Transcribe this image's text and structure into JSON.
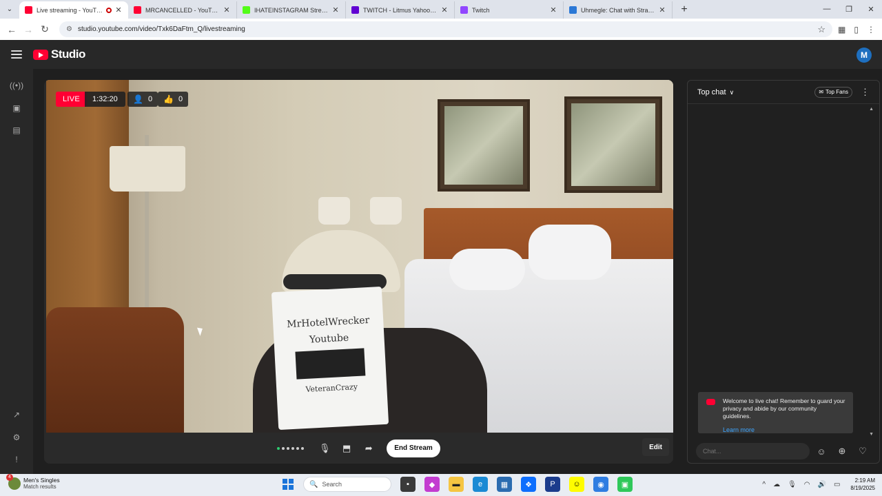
{
  "browser": {
    "tabs": [
      {
        "title": "Live streaming - YouTube Studio",
        "icon": "youtube-studio-icon",
        "color": "#ff0033",
        "active": true,
        "recording": true
      },
      {
        "title": "MRCANCELLED - YouTube",
        "icon": "youtube-icon",
        "color": "#ff0033",
        "active": false
      },
      {
        "title": "IHATEINSTAGRAM Stream - Wa",
        "icon": "kick-icon",
        "color": "#53fc18",
        "active": false
      },
      {
        "title": "TWITCH - Litmus Yahoo Search",
        "icon": "yahoo-icon",
        "color": "#6001d2",
        "active": false
      },
      {
        "title": "Twitch",
        "icon": "twitch-icon",
        "color": "#9146ff",
        "active": false
      },
      {
        "title": "Uhmegle: Chat with Strangers",
        "icon": "uhmegle-icon",
        "color": "#2b78d6",
        "active": false
      }
    ],
    "url": "studio.youtube.com/video/Txk6DaFtm_Q/livestreaming"
  },
  "studio": {
    "logo_text": "Studio",
    "avatar_initial": "M"
  },
  "stream": {
    "live_label": "LIVE",
    "elapsed": "1:32:20",
    "viewers": "0",
    "likes": "0",
    "end_stream_label": "End Stream",
    "edit_label": "Edit",
    "sign_lines": [
      "MrHotelWrecker",
      "Youtube",
      "VeteranCrazy"
    ]
  },
  "chat": {
    "mode_label": "Top chat",
    "top_fans_label": "Top Fans",
    "welcome_text": "Welcome to live chat! Remember to guard your privacy and abide by our community guidelines.",
    "learn_more": "Learn more",
    "input_placeholder": "Chat..."
  },
  "taskbar": {
    "widget_title": "Men's Singles",
    "widget_subtitle": "Match results",
    "widget_badge": "4",
    "search_placeholder": "Search",
    "time": "2:19 AM",
    "date": "8/19/2025"
  },
  "colors": {
    "accent_red": "#ff0033",
    "link_blue": "#3ea6ff",
    "studio_bg": "#282828"
  }
}
